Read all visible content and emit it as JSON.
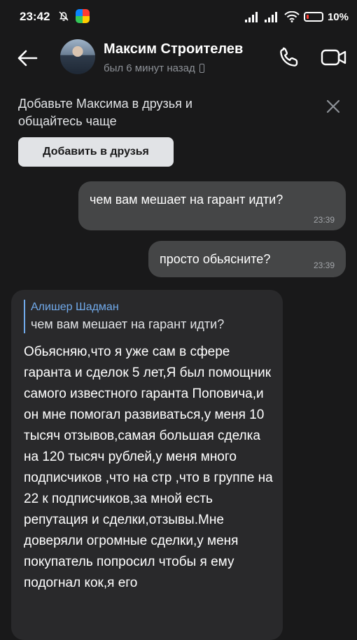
{
  "status_bar": {
    "time": "23:42",
    "battery": "10%",
    "icons": [
      "bell-off-icon",
      "app-icon",
      "signal-icon",
      "signal-icon",
      "wifi-icon",
      "battery-icon"
    ]
  },
  "header": {
    "name": "Максим Строителев",
    "status": "был 6 минут назад"
  },
  "banner": {
    "text": "Добавьте Максима в друзья и общайтесь чаще",
    "button": "Добавить в друзья"
  },
  "messages": [
    {
      "direction": "out",
      "text": "чем вам мешает на гарант идти?",
      "time": "23:39"
    },
    {
      "direction": "out",
      "text": "просто обьясните?",
      "time": "23:39"
    },
    {
      "direction": "in",
      "reply_author": "Алишер Шадман",
      "reply_text": "чем вам мешает на гарант идти?",
      "text": "Обьясняю,что я уже сам в сфере гаранта и сделок 5 лет,Я был помощник самого известного гаранта Поповича,и он мне помогал развиваться,у меня 10 тысяч отзывов,самая большая сделка на 120 тысяч рублей,у меня много подписчиков ,что на стр ,что в группе на 22 к подписчиков,за мной есть репутация и сделки,отзывы.Мне доверяли огромные сделки,у меня покупатель попросил чтобы я ему подогнал кок,я его"
    }
  ],
  "colors": {
    "background": "#19191a",
    "outgoing_bubble": "#454647",
    "incoming_bubble": "#29292b",
    "accent": "#71aaeb"
  }
}
